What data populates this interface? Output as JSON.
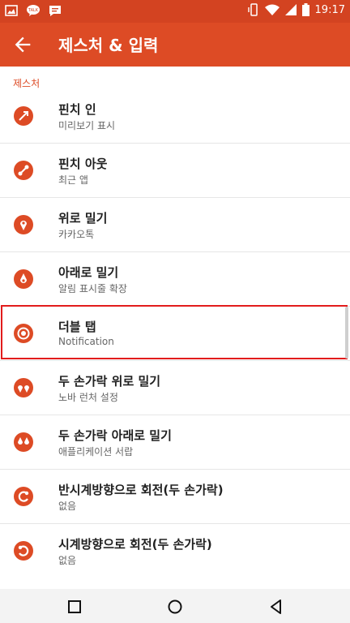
{
  "status_bar": {
    "time": "19:17",
    "left_icons": [
      "image-icon",
      "kakaotalk-icon",
      "message-icon"
    ],
    "right_icons": [
      "vibrate-icon",
      "wifi-icon",
      "signal-icon",
      "battery-icon"
    ]
  },
  "app_bar": {
    "title": "제스처 & 입력",
    "back_icon": "back-arrow-icon",
    "color": "#dd4b25"
  },
  "section": {
    "header": "제스처"
  },
  "gestures": [
    {
      "title": "핀치 인",
      "subtitle": "미리보기 표시",
      "icon": "pinch-in-icon"
    },
    {
      "title": "핀치 아웃",
      "subtitle": "최근 앱",
      "icon": "pinch-out-icon"
    },
    {
      "title": "위로 밀기",
      "subtitle": "카카오톡",
      "icon": "swipe-up-icon"
    },
    {
      "title": "아래로 밀기",
      "subtitle": "알림 표시줄 확장",
      "icon": "swipe-down-icon"
    },
    {
      "title": "더블 탭",
      "subtitle": "Notification",
      "icon": "double-tap-icon",
      "selected": true
    },
    {
      "title": "두 손가락 위로 밀기",
      "subtitle": "노바 런처 설정",
      "icon": "two-finger-up-icon"
    },
    {
      "title": "두 손가락 아래로 밀기",
      "subtitle": "애플리케이션 서랍",
      "icon": "two-finger-down-icon"
    },
    {
      "title": "반시계방향으로 회전(두 손가락)",
      "subtitle": "없음",
      "icon": "rotate-ccw-icon"
    },
    {
      "title": "시계방향으로 회전(두 손가락)",
      "subtitle": "없음",
      "icon": "rotate-cw-icon"
    }
  ],
  "nav": {
    "buttons": [
      "recents-icon",
      "home-icon",
      "back-icon"
    ]
  }
}
